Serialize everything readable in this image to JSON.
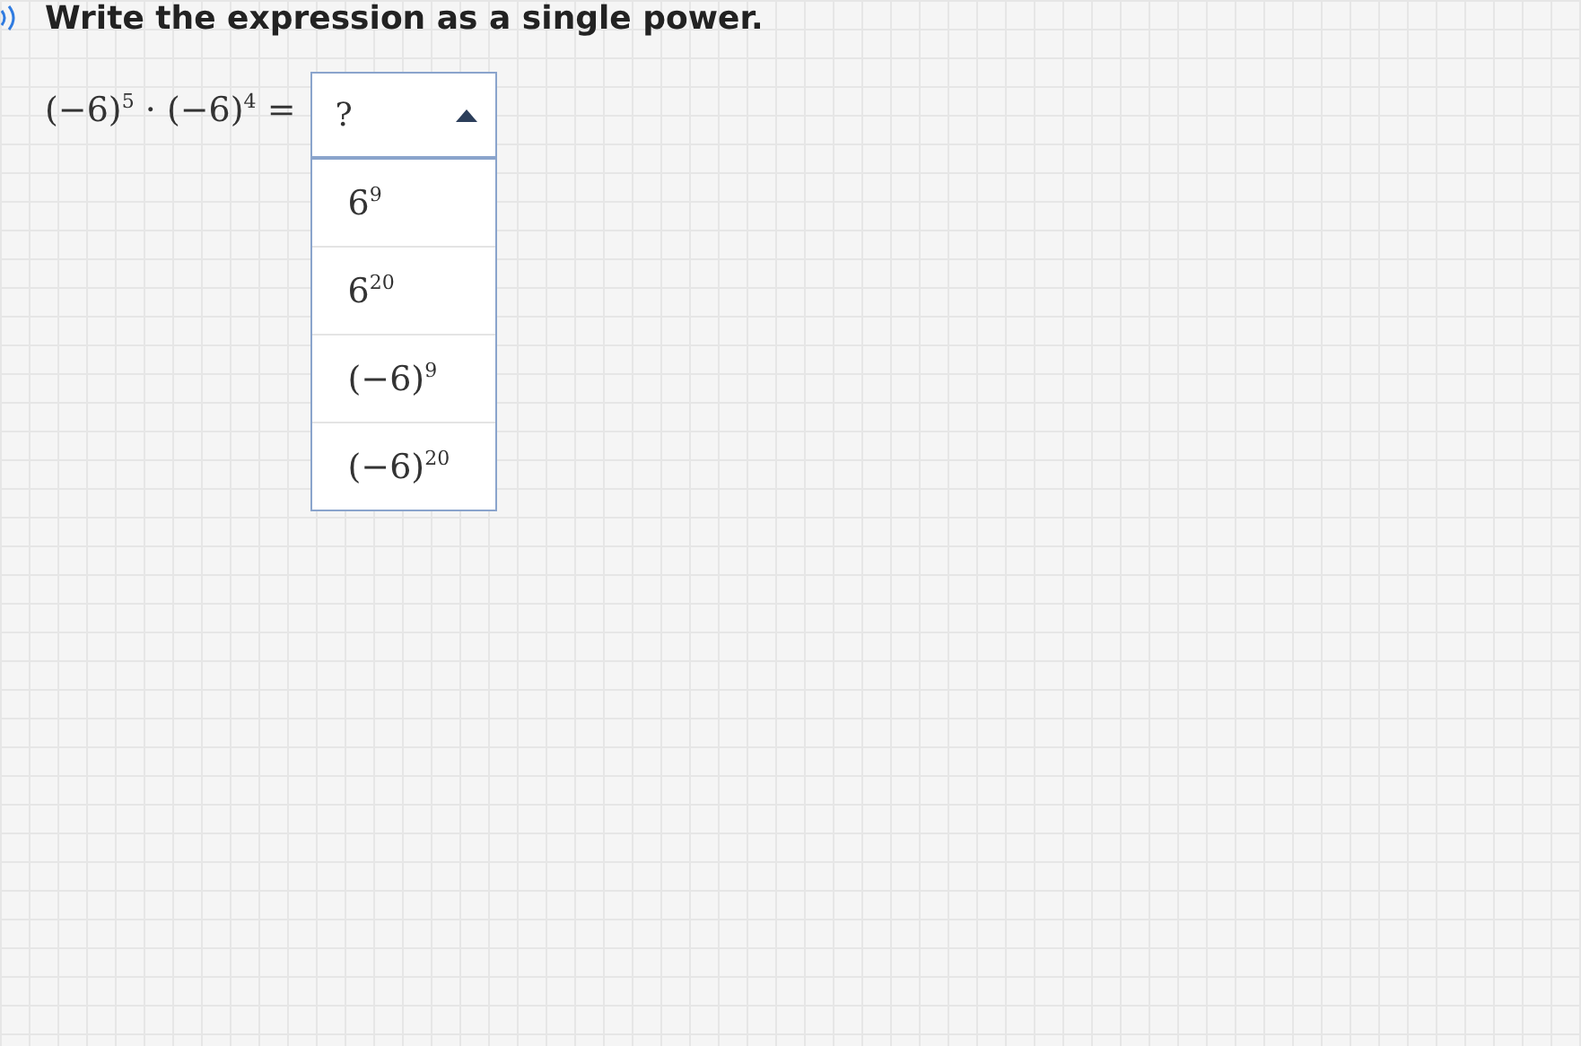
{
  "instruction": "Write the expression as a single power.",
  "question": {
    "expression": "(−6)$^{5}$ · (−6)$^{4}$ =",
    "dropdown": {
      "value": "?",
      "expanded": true,
      "options": [
        "6$^{9}$",
        "6$^{20}$",
        "(−6)$^{9}$",
        "(−6)$^{20}$"
      ]
    }
  }
}
